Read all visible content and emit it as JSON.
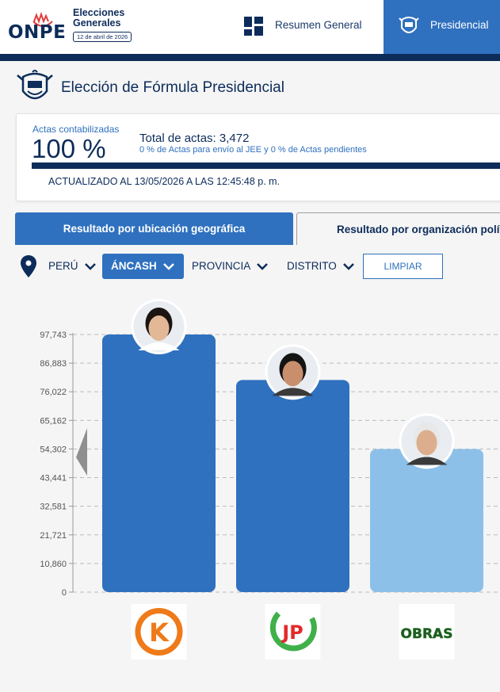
{
  "header": {
    "logo_text": "ONPE",
    "election_title": "Elecciones Generales",
    "election_date": "12 de abril de 2026",
    "nav": [
      {
        "label": "Resumen General",
        "icon": "grid-icon",
        "active": false
      },
      {
        "label": "Presidencial",
        "icon": "peru-coat-of-arms-icon",
        "active": true
      }
    ],
    "colors": {
      "brand_dark": "#0d2c5a",
      "accent": "#2f71bf"
    }
  },
  "page": {
    "title": "Elección de Fórmula Presidencial",
    "icon": "peru-coat-of-arms-icon"
  },
  "summary": {
    "actas_label": "Actas contabilizadas",
    "actas_value": "100 %",
    "actas_progress": 1.0,
    "total_label": "Total de actas:",
    "total_value": "3,472",
    "total_sub": "0 % de Actas para envío al JEE y 0 % de Actas pendientes",
    "updated": "ACTUALIZADO AL 13/05/2026 A LAS 12:45:48 p. m."
  },
  "tabs": [
    {
      "label": "Resultado por ubicación geográfica",
      "active": true
    },
    {
      "label": "Resultado por organización política",
      "active": false
    }
  ],
  "filters": {
    "pin_icon": "location-pin-icon",
    "country": "PERÚ",
    "region": "ÁNCASH",
    "province": "PROVINCIA",
    "district": "DISTRITO",
    "clear_label": "LIMPIAR"
  },
  "chart_data": {
    "type": "bar",
    "y_ticks": [
      "0",
      "10,860",
      "21,721",
      "32,581",
      "43,441",
      "54,302",
      "65,162",
      "76,022",
      "86,883",
      "97,743"
    ],
    "ylim": [
      0,
      97743
    ],
    "grid": true,
    "values": [
      97743,
      80500,
      54302
    ],
    "bar_colors": [
      "#2f71bf",
      "#2f71bf",
      "#8cc0e8"
    ],
    "candidate_icons": [
      "candidate-photo-1",
      "candidate-photo-2",
      "candidate-photo-3"
    ],
    "party_logos": [
      {
        "icon": "party-logo-k-icon",
        "text": "K"
      },
      {
        "icon": "party-logo-jp-icon",
        "text": "JP"
      },
      {
        "icon": "party-logo-obras-icon",
        "text": "OBRAS"
      }
    ]
  }
}
